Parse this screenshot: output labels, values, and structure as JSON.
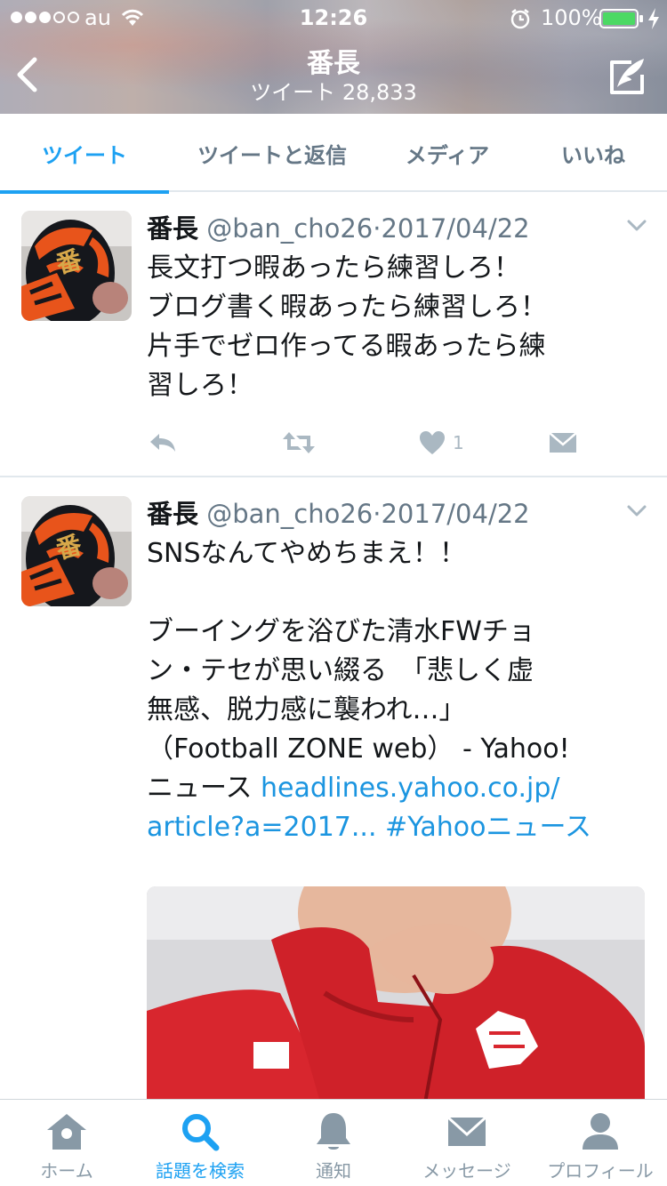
{
  "status_bar": {
    "carrier": "au",
    "time": "12:26",
    "battery": "100%",
    "signal_bars": 3,
    "signal_total": 5
  },
  "header": {
    "title": "番長",
    "subtitle": "ツイート 28,833"
  },
  "tabs": [
    {
      "label": "ツイート",
      "active": true
    },
    {
      "label": "ツイートと返信",
      "active": false
    },
    {
      "label": "メディア",
      "active": false
    },
    {
      "label": "いいね",
      "active": false
    }
  ],
  "tweets": [
    {
      "name": "番長",
      "handle": "@ban_cho26",
      "separator": "·",
      "date": "2017/04/22",
      "lines": [
        "長文打つ暇あったら練習しろ！",
        "ブログ書く暇あったら練習しろ！",
        "片手でゼロ作ってる暇あったら練",
        "習しろ！"
      ],
      "like_count": "1"
    },
    {
      "name": "番長",
      "handle": "@ban_cho26",
      "separator": "·",
      "date": "2017/04/22",
      "lines": [
        "SNSなんてやめちまえ！！",
        "",
        "ブーイングを浴びた清水FWチョ",
        "ン・テセが思い綴る　「悲しく虚",
        "無感、脱力感に襲われ…」",
        "（Football ZONE web） - Yahoo!"
      ],
      "line7_text": "ニュース ",
      "line7_link": "headlines.yahoo.co.jp/",
      "line8_link": "article?a=2017...",
      "line8_hashtag": " #Yahooニュース"
    }
  ],
  "tab_bar": [
    {
      "label": "ホーム",
      "icon": "home-icon",
      "active": false
    },
    {
      "label": "話題を検索",
      "icon": "search-icon",
      "active": true
    },
    {
      "label": "通知",
      "icon": "bell-icon",
      "active": false
    },
    {
      "label": "メッセージ",
      "icon": "envelope-icon",
      "active": false
    },
    {
      "label": "プロフィール",
      "icon": "person-icon",
      "active": false
    }
  ],
  "colors": {
    "accent": "#1da1f2",
    "link": "#1b95e0",
    "muted": "#657786",
    "icon_gray": "#aab8c2",
    "battery_green": "#4cd964",
    "jacket_red": "#d8262e"
  }
}
